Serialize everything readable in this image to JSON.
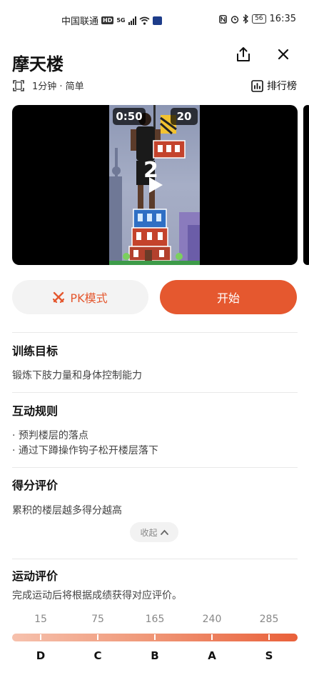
{
  "status_bar": {
    "carrier": "中国联通",
    "hd": "HD",
    "network": "5G",
    "battery": "56",
    "time": "16:35"
  },
  "header": {
    "title": "摩天楼",
    "share_icon": "share-icon",
    "close_icon": "close-icon"
  },
  "meta": {
    "duration_difficulty": "1分钟 · 简单",
    "leaderboard_label": "排行榜"
  },
  "video": {
    "timer": "0:50",
    "score": "20",
    "countdown": "2"
  },
  "actions": {
    "pk_label": "PK模式",
    "start_label": "开始"
  },
  "goal": {
    "title": "训练目标",
    "text": "锻炼下肢力量和身体控制能力"
  },
  "rules": {
    "title": "互动规则",
    "items": [
      "· 预判楼层的落点",
      "· 通过下蹲操作钩子松开楼层落下"
    ]
  },
  "scoring": {
    "title": "得分评价",
    "text": "累积的楼层越多得分越高",
    "collapse_label": "收起"
  },
  "evaluation": {
    "title": "运动评价",
    "text": "完成运动后将根据成绩获得对应评价。",
    "scores": [
      "15",
      "75",
      "165",
      "240",
      "285"
    ],
    "grades": [
      "D",
      "C",
      "B",
      "A",
      "S"
    ]
  },
  "colors": {
    "accent": "#e5582f",
    "pk_text": "#e4572e"
  }
}
